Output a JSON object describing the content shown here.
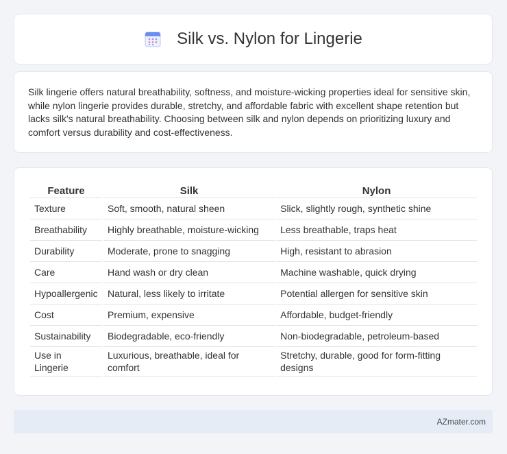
{
  "header": {
    "title": "Silk vs. Nylon for Lingerie",
    "icon": "calendar-icon"
  },
  "intro": {
    "text": "Silk lingerie offers natural breathability, softness, and moisture-wicking properties ideal for sensitive skin, while nylon lingerie provides durable, stretchy, and affordable fabric with excellent shape retention but lacks silk's natural breathability. Choosing between silk and nylon depends on prioritizing luxury and comfort versus durability and cost-effectiveness."
  },
  "table": {
    "headers": [
      "Feature",
      "Silk",
      "Nylon"
    ],
    "rows": [
      [
        "Texture",
        "Soft, smooth, natural sheen",
        "Slick, slightly rough, synthetic shine"
      ],
      [
        "Breathability",
        "Highly breathable, moisture-wicking",
        "Less breathable, traps heat"
      ],
      [
        "Durability",
        "Moderate, prone to snagging",
        "High, resistant to abrasion"
      ],
      [
        "Care",
        "Hand wash or dry clean",
        "Machine washable, quick drying"
      ],
      [
        "Hypoallergenic",
        "Natural, less likely to irritate",
        "Potential allergen for sensitive skin"
      ],
      [
        "Cost",
        "Premium, expensive",
        "Affordable, budget-friendly"
      ],
      [
        "Sustainability",
        "Biodegradable, eco-friendly",
        "Non-biodegradable, petroleum-based"
      ],
      [
        "Use in Lingerie",
        "Luxurious, breathable, ideal for comfort",
        "Stretchy, durable, good for form-fitting designs"
      ]
    ]
  },
  "footer": {
    "brand": "AZmater.com"
  },
  "colors": {
    "background": "#f2f4f8",
    "card": "#ffffff",
    "footer": "#e6ecf6",
    "icon_accent": "#6b8df0"
  }
}
